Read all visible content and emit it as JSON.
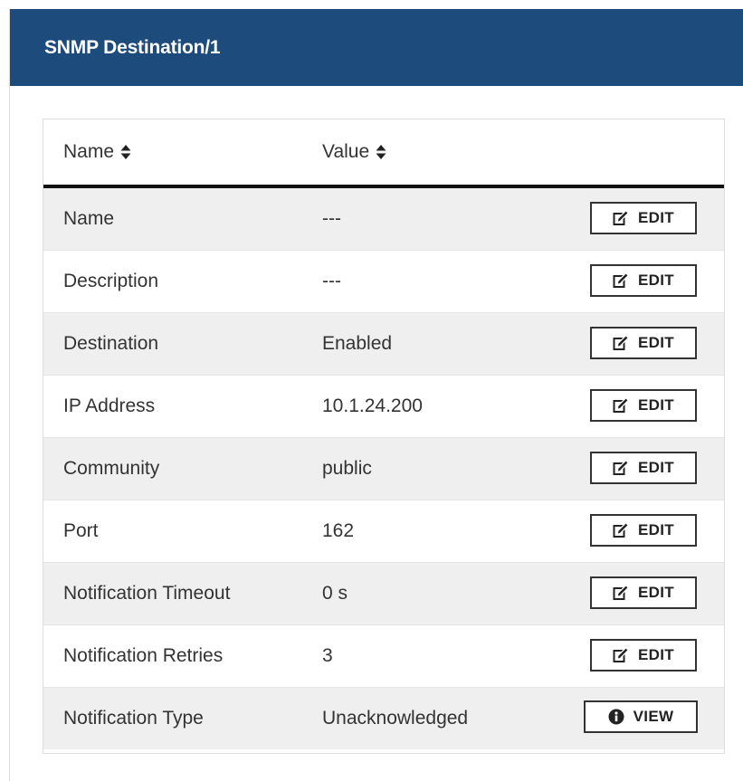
{
  "panel": {
    "title": "SNMP Destination/1"
  },
  "table": {
    "columns": [
      {
        "label": "Name",
        "icon": "sort-icon"
      },
      {
        "label": "Value",
        "icon": "sort-icon"
      }
    ],
    "rows": [
      {
        "name": "Name",
        "value": "---",
        "action": "EDIT",
        "action_icon": "edit-icon"
      },
      {
        "name": "Description",
        "value": "---",
        "action": "EDIT",
        "action_icon": "edit-icon"
      },
      {
        "name": "Destination",
        "value": "Enabled",
        "action": "EDIT",
        "action_icon": "edit-icon"
      },
      {
        "name": "IP Address",
        "value": "10.1.24.200",
        "action": "EDIT",
        "action_icon": "edit-icon"
      },
      {
        "name": "Community",
        "value": "public",
        "action": "EDIT",
        "action_icon": "edit-icon"
      },
      {
        "name": "Port",
        "value": "162",
        "action": "EDIT",
        "action_icon": "edit-icon"
      },
      {
        "name": "Notification Timeout",
        "value": "0 s",
        "action": "EDIT",
        "action_icon": "edit-icon"
      },
      {
        "name": "Notification Retries",
        "value": "3",
        "action": "EDIT",
        "action_icon": "edit-icon"
      },
      {
        "name": "Notification Type",
        "value": "Unacknowledged",
        "action": "VIEW",
        "action_icon": "info-icon"
      }
    ]
  },
  "colors": {
    "header_bg": "#1d4b7c",
    "header_text": "#ffffff",
    "stripe": "#efefef"
  }
}
